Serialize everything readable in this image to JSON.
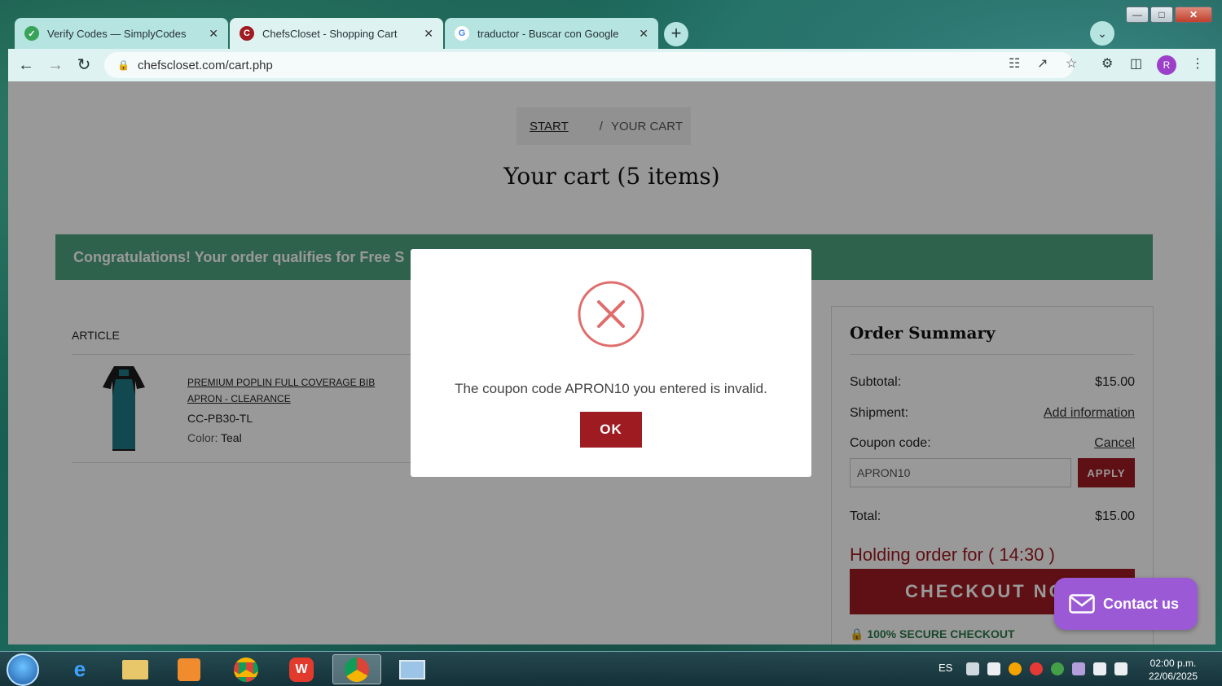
{
  "browser": {
    "tabs": [
      {
        "label": "Verify Codes — SimplyCodes",
        "icon": "simplycodes-icon",
        "color": "#3aa35a"
      },
      {
        "label": "ChefsCloset - Shopping Cart",
        "icon": "chefscloset-icon",
        "color": "#9e1b22"
      },
      {
        "label": "traductor - Buscar con Google",
        "icon": "google-icon",
        "color": "#4285f4"
      }
    ],
    "url": "chefscloset.com/cart.php",
    "profile_initial": "R"
  },
  "page": {
    "breadcrumb": {
      "start": "START",
      "separator": "/",
      "current": "YOUR CART"
    },
    "title": "Your cart (5 items)",
    "banner": "Congratulations! Your order qualifies for Free S",
    "article_header": "ARTICLE",
    "product": {
      "name": "PREMIUM POPLIN FULL COVERAGE BIB APRON - CLEARANCE",
      "sku": "CC-PB30-TL",
      "color_label": "Color:",
      "color_value": "Teal"
    },
    "summary": {
      "title": "Order Summary",
      "subtotal_label": "Subtotal:",
      "subtotal_value": "$15.00",
      "shipment_label": "Shipment:",
      "shipment_link": "Add information",
      "coupon_label": "Coupon code:",
      "coupon_cancel": "Cancel",
      "coupon_value": "APRON10",
      "apply_label": "APPLY",
      "total_label": "Total:",
      "total_value": "$15.00",
      "holding": "Holding order for ( 14:30 )",
      "checkout_label": "CHECKOUT NOW",
      "secure": "100% SECURE CHECKOUT"
    },
    "contact_label": "Contact us"
  },
  "modal": {
    "message": "The coupon code APRON10 you entered is invalid.",
    "ok_label": "OK",
    "error_color": "#e06c6c"
  },
  "taskbar": {
    "language": "ES",
    "time": "02:00 p.m.",
    "date": "22/06/2025"
  }
}
